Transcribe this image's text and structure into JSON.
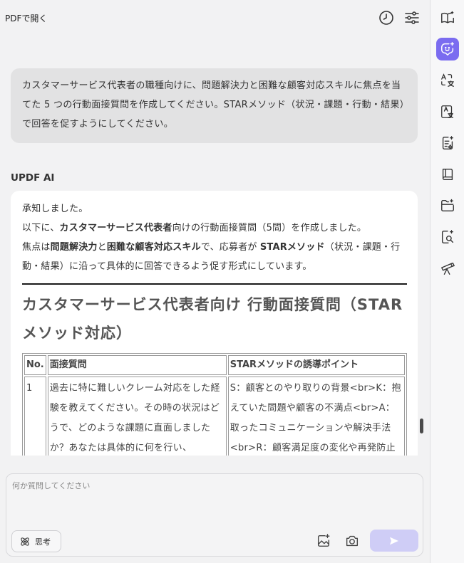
{
  "topbar": {
    "open_pdf": "PDFで開く",
    "history_icon": "clock-icon",
    "settings_icon": "sliders-icon"
  },
  "chat": {
    "user_message": "カスタマーサービス代表者の職種向けに、問題解決力と困難な顧客対応スキルに焦点を当てた 5 つの行動面接質問を作成してください。STARメソッド（状況・課題・行動・結果）で回答を促すようにしてください。",
    "ai_label": "UPDF AI",
    "ai_response": {
      "line1": "承知しました。",
      "line2_pre": "以下に、",
      "line2_bold": "カスタマーサービス代表者",
      "line2_post": "向けの行動面接質問（5問）を作成しました。",
      "line3_pre": "焦点は",
      "line3_bold1": "問題解決力",
      "line3_mid": "と",
      "line3_bold2": "困難な顧客対応スキル",
      "line3_mid2": "で、応募者が ",
      "line3_bold3": "STARメソッド",
      "line3_post": "（状況・課題・行動・結果）に沿って具体的に回答できるよう促す形式にしています。",
      "heading": "カスタマーサービス代表者向け 行動面接質問（STARメソッド対応）",
      "table": {
        "headers": [
          "No.",
          "面接質問",
          "STARメソッドの誘導ポイント"
        ],
        "rows": [
          {
            "no": "1",
            "question": "過去に特に難しいクレーム対応をした経験を教えてください。その時の状況はどうで、どのような課題に直面しましたか？あなたは具体的に何を行い、",
            "star": "S：顧客とのやり取りの背景<br>K：抱えていた問題や顧客の不満点<br>A：取ったコミュニケーションや解決手法<br>R：顧客満足度の変化や再発防止"
          }
        ]
      }
    }
  },
  "input": {
    "placeholder": "何か質問してください",
    "value": "",
    "think_label": "思考",
    "image_icon": "image-sparkle-icon",
    "camera_icon": "camera-icon",
    "send_icon": "send-icon"
  },
  "sidebar": {
    "items": [
      "book-sparkle-icon",
      "ai-chat-icon",
      "translate-icon",
      "translate-page-icon",
      "summarize-icon",
      "book-icon",
      "folder-sparkle-icon",
      "search-ai-icon",
      "telescope-icon"
    ],
    "active_color": "#7b6cf0"
  }
}
